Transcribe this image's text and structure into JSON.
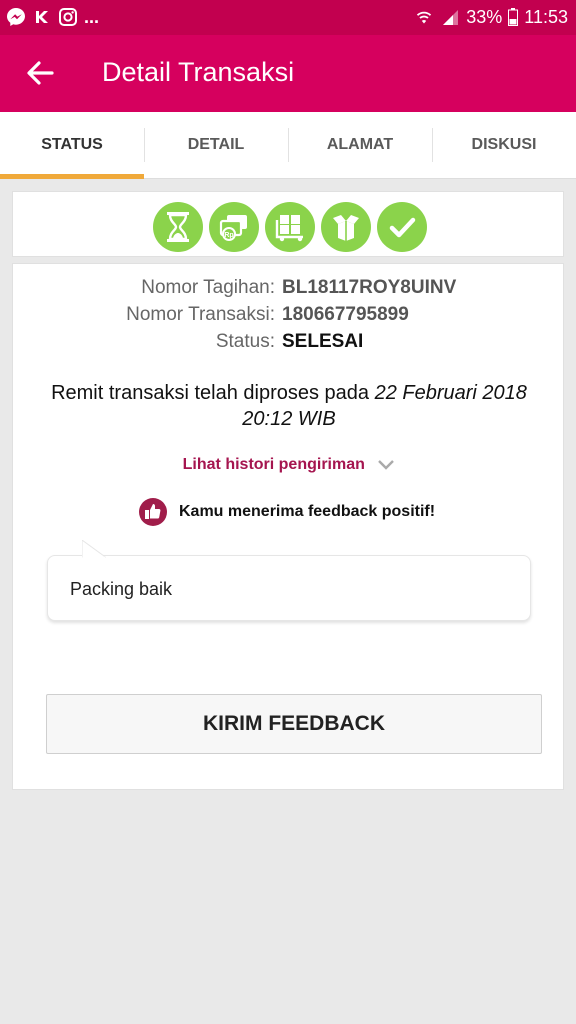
{
  "status_bar": {
    "notification_icons": [
      "messenger-icon",
      "kaskus-icon",
      "instagram-icon"
    ],
    "more": "...",
    "battery": "33%",
    "time": "11:53"
  },
  "app_bar": {
    "title": "Detail Transaksi"
  },
  "tabs": [
    {
      "label": "STATUS",
      "active": true
    },
    {
      "label": "DETAIL",
      "active": false
    },
    {
      "label": "ALAMAT",
      "active": false
    },
    {
      "label": "DISKUSI",
      "active": false
    }
  ],
  "steps": [
    "hourglass-icon",
    "payment-icon",
    "shipping-box-icon",
    "package-delivered-icon",
    "checkmark-icon"
  ],
  "info": {
    "bill_label": "Nomor Tagihan:",
    "bill_value": "BL18117ROY8UINV",
    "trx_label": "Nomor Transaksi:",
    "trx_value": "180667795899",
    "status_label": "Status:",
    "status_value": "SELESAI"
  },
  "message": {
    "text": "Remit transaksi telah diproses pada ",
    "date": "22 Februari 2018 20:12 WIB"
  },
  "history_link": "Lihat histori pengiriman",
  "feedback_notice": "Kamu menerima feedback positif!",
  "feedback_comment": "Packing baik",
  "send_feedback_button": "KIRIM FEEDBACK",
  "colors": {
    "status_bar": "#c2004f",
    "app_bar": "#d6005e",
    "tab_indicator": "#f0a93a",
    "step_green": "#8bd34b",
    "link": "#a5154f"
  }
}
